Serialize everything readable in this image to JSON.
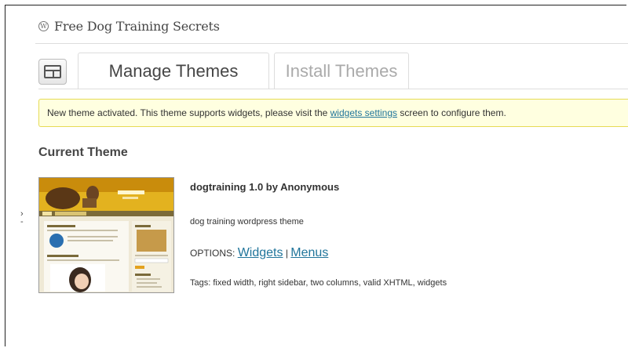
{
  "site": {
    "title": "Free Dog Training Secrets"
  },
  "tabs": [
    {
      "label": "Manage Themes",
      "active": true
    },
    {
      "label": "Install Themes",
      "active": false
    }
  ],
  "notice": {
    "before": "New theme activated. This theme supports widgets, please visit the",
    "link": "widgets settings",
    "after": "screen to configure them."
  },
  "current_theme": {
    "heading": "Current Theme",
    "name": "dogtraining 1.0 by Anonymous",
    "description": "dog training wordpress theme",
    "options_label": "OPTIONS:",
    "options": [
      "Widgets",
      "Menus"
    ],
    "options_separator": "|",
    "tags": "Tags: fixed width, right sidebar, two columns, valid XHTML, widgets"
  },
  "colors": {
    "link": "#21759b",
    "notice_bg": "#ffffe0",
    "notice_border": "#e6db55"
  },
  "icons": {
    "site_logo": "wordpress-logo-icon",
    "themes_screen": "themes-layout-icon"
  }
}
